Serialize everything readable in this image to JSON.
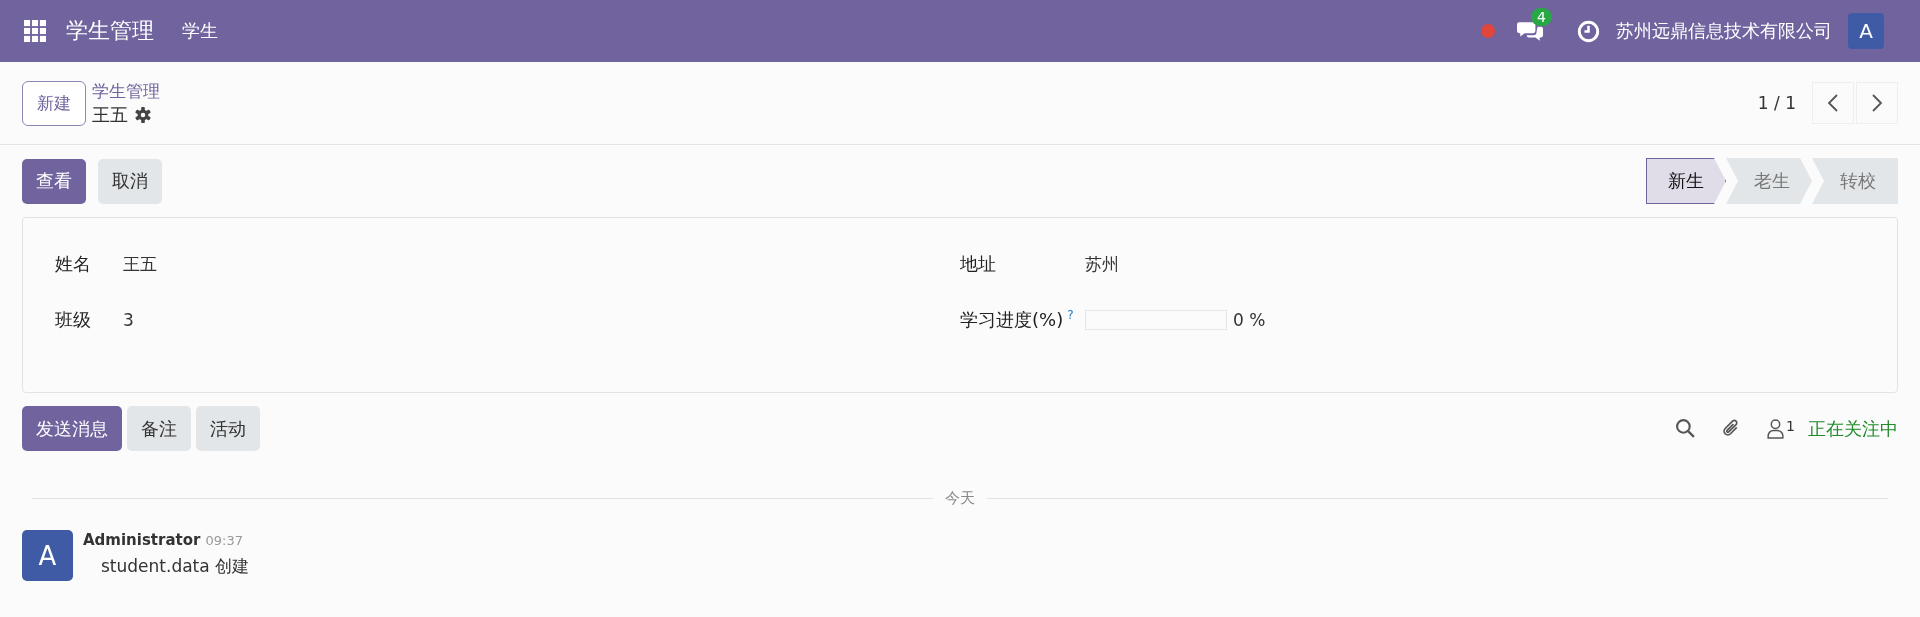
{
  "navbar": {
    "app_name": "学生管理",
    "menu": [
      "学生"
    ],
    "messages_badge": "4",
    "company": "苏州远鼎信息技术有限公司",
    "user_initial": "A"
  },
  "control_panel": {
    "new_button": "新建",
    "breadcrumb": "学生管理",
    "record_name": "王五",
    "pager": "1 / 1"
  },
  "actions": [
    {
      "label": "查看",
      "kind": "primary"
    },
    {
      "label": "取消",
      "kind": "secondary"
    }
  ],
  "stages": [
    {
      "label": "新生",
      "selected": true
    },
    {
      "label": "老生",
      "selected": false
    },
    {
      "label": "转校",
      "selected": false
    }
  ],
  "form": {
    "left": [
      {
        "label": "姓名",
        "value": "王五"
      },
      {
        "label": "班级",
        "value": "3"
      }
    ],
    "address": {
      "label": "地址",
      "value": "苏州"
    },
    "progress": {
      "label": "学习进度(%)",
      "help": "?",
      "level": 0,
      "reading": "0 %"
    }
  },
  "chatter": {
    "buttons": [
      {
        "label": "发送消息",
        "kind": "primary"
      },
      {
        "label": "备注",
        "kind": "secondary"
      },
      {
        "label": "活动",
        "kind": "secondary"
      }
    ],
    "followers_count": "1",
    "follow_status": "正在关注中",
    "date_separator": "今天",
    "messages": [
      {
        "initial": "A",
        "author": "Administrator",
        "time": "09:37",
        "body": "student.data 创建"
      }
    ]
  }
}
